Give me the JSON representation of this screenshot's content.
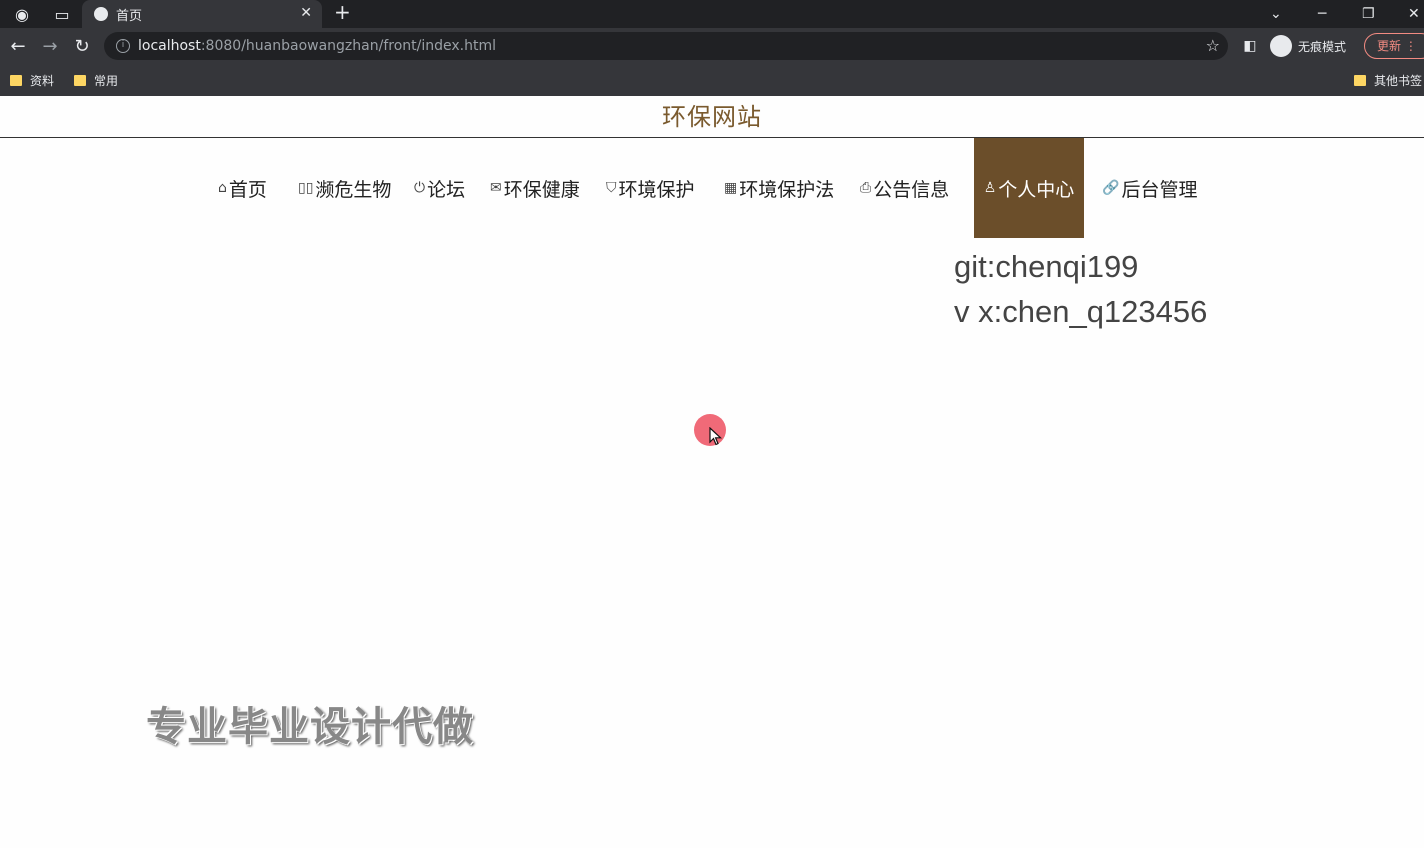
{
  "browser": {
    "tab_title": "首页",
    "new_tab": "+",
    "close": "✕",
    "url_host": "localhost",
    "url_rest": ":8080/huanbaowangzhan/front/index.html",
    "incognito_label": "无痕模式",
    "update_label": "更新",
    "bookmarks": [
      "资料",
      "常用"
    ],
    "other_bookmarks": "其他书签"
  },
  "site": {
    "title": "环保网站",
    "nav": [
      {
        "icon": "⌂",
        "label": "首页"
      },
      {
        "icon": "▯▯",
        "label": "濒危生物"
      },
      {
        "icon": "⏻",
        "label": "论坛"
      },
      {
        "icon": "✉",
        "label": "环保健康"
      },
      {
        "icon": "⛉",
        "label": "环境保护"
      },
      {
        "icon": "▦",
        "label": "环境保护法"
      },
      {
        "icon": "⎙",
        "label": "公告信息"
      },
      {
        "icon": "♙",
        "label": "个人中心"
      },
      {
        "icon": "🔗",
        "label": "后台管理"
      }
    ],
    "active_nav": "个人中心"
  },
  "overlay": {
    "line1": "git:chenqi199",
    "line2": "v x:chen_q123456",
    "promo": "专业毕业设计代做"
  },
  "colors": {
    "accent": "#6b4e2a",
    "title": "#7a5a2e"
  }
}
